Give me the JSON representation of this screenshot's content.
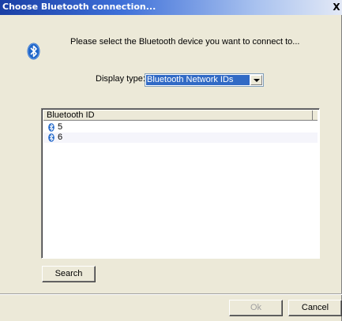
{
  "window": {
    "title": "Choose Bluetooth connection...",
    "close_glyph": "X"
  },
  "prompt": "Please select the Bluetooth device you want to connect to...",
  "display_type": {
    "label": "Display type:",
    "selected": "Bluetooth Network IDs"
  },
  "list": {
    "column_header": "Bluetooth ID",
    "rows": [
      {
        "id": "5",
        "icon": "bluetooth-icon"
      },
      {
        "id": "6",
        "icon": "bluetooth-icon"
      }
    ]
  },
  "buttons": {
    "search": "Search",
    "ok": "Ok",
    "cancel": "Cancel"
  },
  "colors": {
    "bluetooth_blue": "#1f66c9",
    "selection": "#316ac5"
  }
}
